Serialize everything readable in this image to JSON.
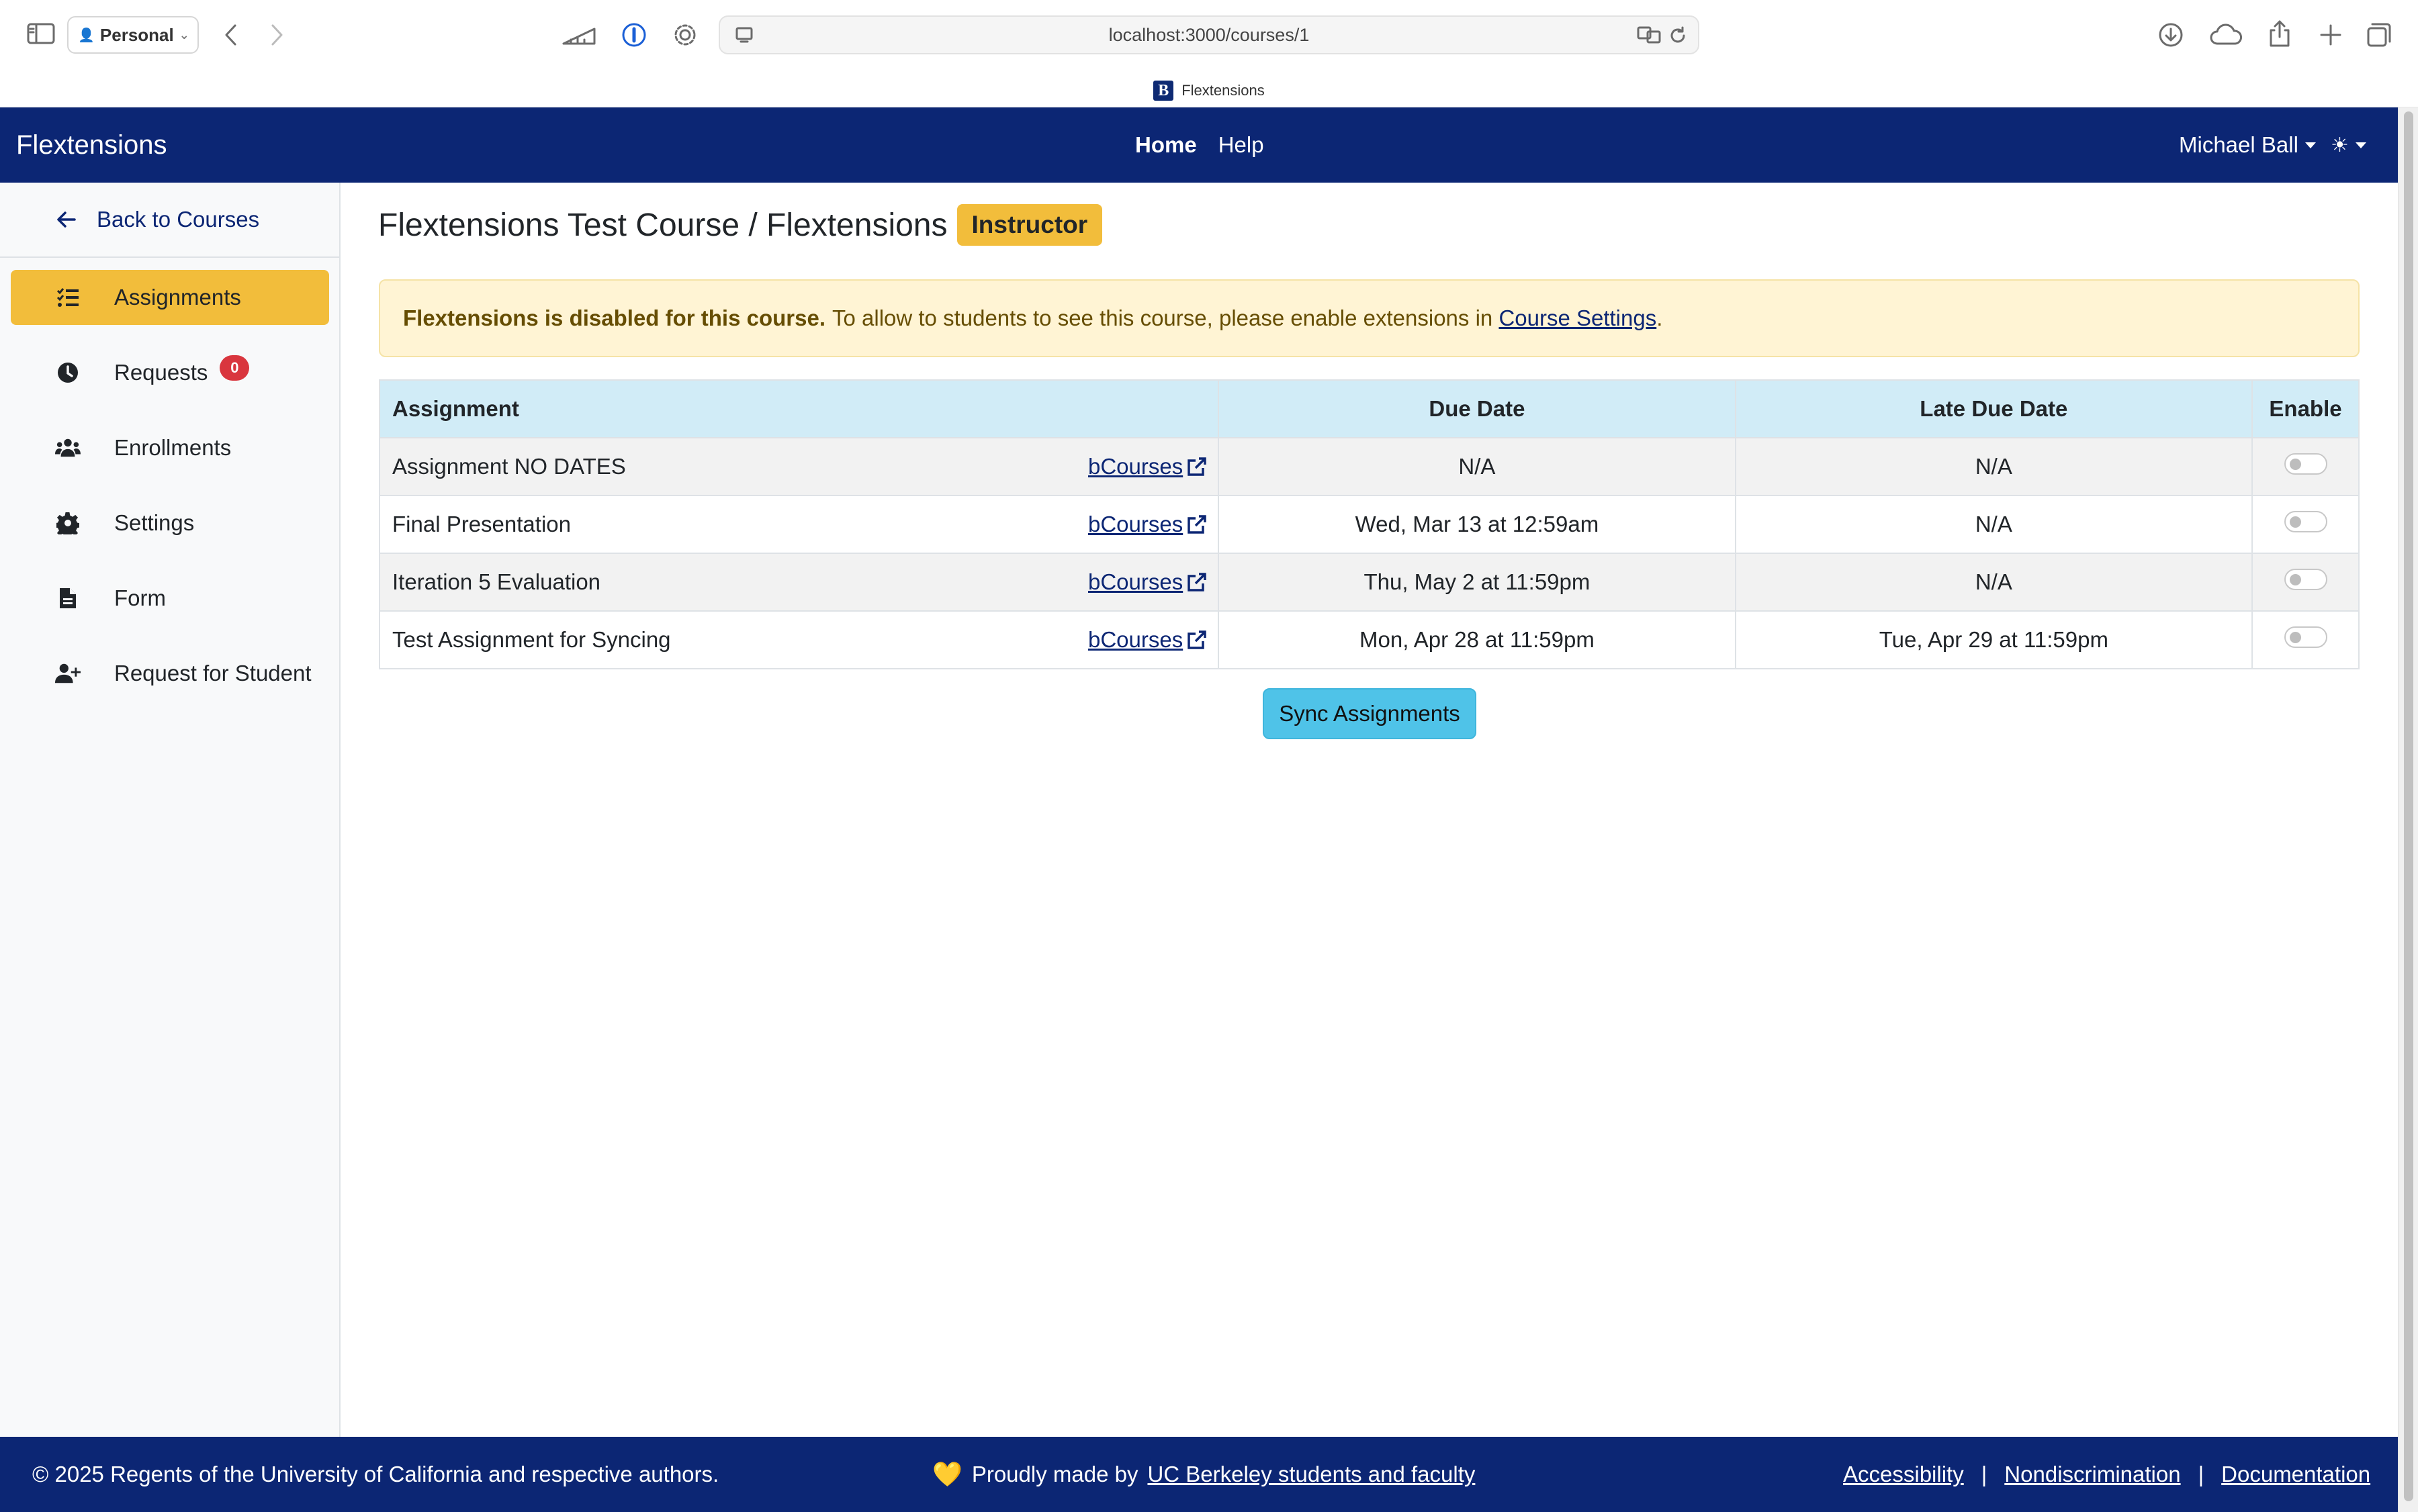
{
  "browser": {
    "profile_label": "Personal",
    "url": "localhost:3000/courses/1",
    "tab_title": "Flextensions",
    "favicon_letter": "B"
  },
  "navbar": {
    "brand": "Flextensions",
    "links": [
      "Home",
      "Help"
    ],
    "user_name": "Michael Ball",
    "theme_icon": "☀"
  },
  "sidebar": {
    "back_label": "Back to Courses",
    "items": [
      {
        "label": "Assignments",
        "icon": "list-check-icon",
        "active": true
      },
      {
        "label": "Requests",
        "icon": "clock-icon",
        "badge": "0"
      },
      {
        "label": "Enrollments",
        "icon": "users-icon"
      },
      {
        "label": "Settings",
        "icon": "gear-icon"
      },
      {
        "label": "Form",
        "icon": "file-icon"
      },
      {
        "label": "Request for Student",
        "icon": "user-plus-icon"
      }
    ]
  },
  "main": {
    "title": "Flextensions Test Course / Flextensions",
    "role_badge": "Instructor",
    "alert": {
      "bold": "Flextensions is disabled for this course.",
      "text": "To allow to students to see this course, please enable extensions in",
      "link": "Course Settings",
      "end": "."
    },
    "table": {
      "headers": [
        "Assignment",
        "Due Date",
        "Late Due Date",
        "Enable"
      ],
      "link_label": "bCourses",
      "rows": [
        {
          "name": "Assignment NO DATES",
          "due": "N/A",
          "late": "N/A",
          "enabled": false
        },
        {
          "name": "Final Presentation",
          "due": "Wed, Mar 13 at 12:59am",
          "late": "N/A",
          "enabled": false
        },
        {
          "name": "Iteration 5 Evaluation",
          "due": "Thu, May 2 at 11:59pm",
          "late": "N/A",
          "enabled": false
        },
        {
          "name": "Test Assignment for Syncing",
          "due": "Mon, Apr 28 at 11:59pm",
          "late": "Tue, Apr 29 at 11:59pm",
          "enabled": false
        }
      ]
    },
    "sync_button": "Sync Assignments"
  },
  "footer": {
    "copyright": "© 2025 Regents of the University of California and respective authors.",
    "heart": "💛",
    "made_by": "Proudly made by",
    "made_by_link": "UC Berkeley students and faculty",
    "links": [
      "Accessibility",
      "Nondiscrimination",
      "Documentation"
    ],
    "separator": "|"
  }
}
